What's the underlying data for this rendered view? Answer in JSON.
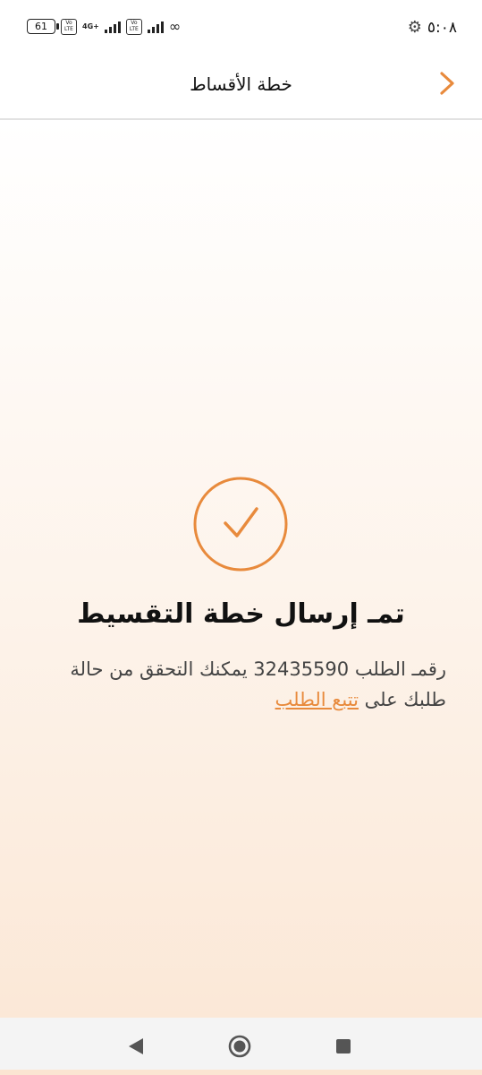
{
  "status_bar": {
    "time": "٥:٠٨",
    "battery": "61",
    "network": "4G+",
    "volte": "Vo LTE"
  },
  "header": {
    "title": "خطة الأقساط",
    "back_icon": "chevron-right-icon"
  },
  "result": {
    "title": "تمـ إرسال خطة التقسيط",
    "message_prefix": "رقمـ الطلب 32435590 يمكنك التحقق من حالة طلبك على ",
    "link_text": "تتبع الطلب",
    "icon": "check-circle-icon"
  },
  "colors": {
    "accent": "#e88a3c",
    "background_bottom": "#fbe8d7"
  }
}
